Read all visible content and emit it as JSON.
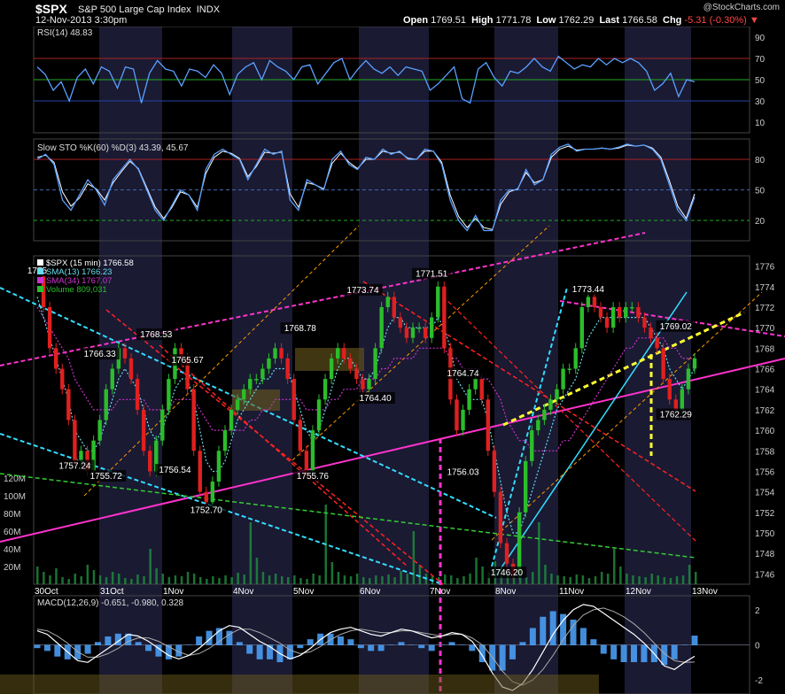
{
  "header": {
    "symbol": "$SPX",
    "name": "S&P 500 Large Cap Index",
    "exchange": "INDX",
    "datetime": "12-Nov-2013 3:30pm",
    "brand": "@StockCharts.com",
    "open_label": "Open",
    "open": "1769.51",
    "high_label": "High",
    "high": "1771.78",
    "low_label": "Low",
    "low": "1762.29",
    "last_label": "Last",
    "last": "1766.58",
    "chg_label": "Chg",
    "chg": "-5.31 (-0.30%)"
  },
  "colors": {
    "background": "#000000",
    "band": "#1a1a33",
    "price_up": "#2bbd2b",
    "price_down": "#e02020",
    "rsi_line": "#5aa0ff",
    "magenta": "#ff33cc",
    "cyan": "#33ddff",
    "red": "#ff2222",
    "orange": "#ff9900",
    "yellow": "#ffff33",
    "green_dash": "#33cc33",
    "volume": "#1f8f3f",
    "macd_hist": "#4da6ff"
  },
  "chart_data": [
    {
      "type": "line",
      "title": "RSI(14) 48.83",
      "ylim": [
        0,
        100
      ],
      "y_ticks": [
        "90",
        "70",
        "50",
        "30",
        "10"
      ],
      "reference_lines": [
        70,
        50,
        30
      ],
      "series": [
        {
          "name": "RSI(14)",
          "values": [
            62,
            55,
            40,
            48,
            30,
            52,
            60,
            46,
            62,
            58,
            42,
            62,
            60,
            28,
            56,
            68,
            60,
            58,
            44,
            60,
            58,
            52,
            64,
            56,
            36,
            55,
            62,
            66,
            50,
            68,
            62,
            58,
            50,
            62,
            64,
            46,
            56,
            66,
            70,
            50,
            60,
            68,
            60,
            56,
            62,
            54,
            62,
            60,
            58,
            40,
            46,
            54,
            62,
            32,
            28,
            60,
            66,
            52,
            44,
            58,
            56,
            62,
            70,
            62,
            58,
            72,
            66,
            60,
            64,
            62,
            70,
            64,
            70,
            66,
            70,
            66,
            58,
            40,
            46,
            56,
            34,
            50,
            48
          ]
        }
      ]
    },
    {
      "type": "line",
      "title": "Slow STO %K(60) %D(3) 43.39, 45.67",
      "ylim": [
        0,
        100
      ],
      "y_ticks": [
        "80",
        "50",
        "20"
      ],
      "reference_lines": [
        80,
        50,
        20
      ],
      "series": [
        {
          "name": "%K(60)",
          "values": [
            80,
            85,
            75,
            40,
            30,
            45,
            60,
            50,
            35,
            60,
            70,
            80,
            70,
            50,
            30,
            20,
            35,
            50,
            45,
            30,
            70,
            85,
            90,
            85,
            80,
            60,
            75,
            90,
            85,
            88,
            40,
            30,
            60,
            55,
            50,
            80,
            88,
            75,
            70,
            82,
            80,
            90,
            85,
            88,
            80,
            80,
            90,
            88,
            75,
            40,
            20,
            10,
            25,
            10,
            10,
            40,
            50,
            50,
            70,
            55,
            60,
            85,
            92,
            95,
            88,
            90,
            90,
            91,
            90,
            92,
            95,
            93,
            94,
            90,
            80,
            55,
            30,
            20,
            43
          ]
        },
        {
          "name": "%D(3)",
          "values": [
            82,
            84,
            77,
            48,
            34,
            42,
            56,
            51,
            40,
            57,
            68,
            78,
            71,
            52,
            33,
            22,
            33,
            48,
            45,
            33,
            66,
            82,
            88,
            86,
            81,
            63,
            73,
            87,
            86,
            87,
            46,
            33,
            57,
            55,
            51,
            76,
            86,
            77,
            71,
            80,
            80,
            88,
            86,
            87,
            81,
            80,
            88,
            88,
            77,
            45,
            24,
            13,
            22,
            13,
            11,
            36,
            48,
            51,
            67,
            57,
            60,
            82,
            90,
            93,
            89,
            90,
            90,
            91,
            90,
            91,
            94,
            93,
            94,
            91,
            82,
            59,
            34,
            22,
            46
          ]
        }
      ]
    },
    {
      "type": "line",
      "title": "$SPX (15 min) 1766.58",
      "ylim": [
        1745,
        1777
      ],
      "y_ticks": [
        "1776",
        "1774",
        "1772",
        "1770",
        "1768",
        "1766",
        "1764",
        "1762",
        "1760",
        "1758",
        "1756",
        "1754",
        "1752",
        "1750",
        "1748",
        "1746"
      ],
      "x": [
        "30Oct",
        "31Oct",
        "1Nov",
        "4Nov",
        "5Nov",
        "6Nov",
        "7Nov",
        "8Nov",
        "11Nov",
        "12Nov",
        "13Nov"
      ],
      "series": [
        {
          "name": "$SPX (15 min)",
          "values": [
            1775,
            1772,
            1768,
            1766,
            1764,
            1761,
            1757,
            1758,
            1756,
            1759,
            1761,
            1764,
            1766,
            1768,
            1767,
            1765,
            1762,
            1758,
            1756,
            1759,
            1762,
            1765,
            1768,
            1767,
            1764,
            1758,
            1754,
            1753,
            1755,
            1758,
            1760,
            1762,
            1763,
            1764,
            1765,
            1765,
            1766,
            1767,
            1768,
            1767,
            1765,
            1761,
            1758,
            1756,
            1760,
            1763,
            1765,
            1767,
            1768,
            1767,
            1766,
            1765,
            1764,
            1765,
            1768,
            1772,
            1773,
            1771,
            1770,
            1769,
            1770,
            1770,
            1769,
            1771,
            1774,
            1768,
            1763,
            1760,
            1762,
            1764,
            1765,
            1763,
            1758,
            1754,
            1749,
            1747,
            1746,
            1752,
            1757,
            1760,
            1761,
            1762,
            1763,
            1764,
            1766,
            1766,
            1768,
            1772,
            1773,
            1772,
            1771,
            1770,
            1772,
            1771,
            1772,
            1772,
            1771,
            1770,
            1769,
            1768,
            1765,
            1763,
            1762,
            1764,
            1766,
            1767
          ]
        },
        {
          "name": "SMA(13) 1766.23",
          "values": [
            1773,
            1771,
            1769,
            1767,
            1765,
            1763,
            1760,
            1759,
            1758,
            1758,
            1759,
            1761,
            1763,
            1765,
            1766,
            1765,
            1764,
            1762,
            1760,
            1759,
            1760,
            1762,
            1764,
            1765,
            1765,
            1763,
            1760,
            1757,
            1756,
            1756,
            1757,
            1759,
            1761,
            1762,
            1763,
            1764,
            1765,
            1765,
            1766,
            1766,
            1766,
            1764,
            1762,
            1760,
            1759,
            1760,
            1762,
            1764,
            1766,
            1767,
            1767,
            1766,
            1765,
            1765,
            1766,
            1768,
            1770,
            1771,
            1771,
            1770,
            1770,
            1770,
            1770,
            1770,
            1771,
            1770,
            1768,
            1765,
            1764,
            1763,
            1763,
            1763,
            1761,
            1758,
            1755,
            1752,
            1750,
            1750,
            1752,
            1754,
            1756,
            1758,
            1760,
            1762,
            1763,
            1764,
            1765,
            1767,
            1769,
            1770,
            1771,
            1771,
            1771,
            1771,
            1771,
            1771,
            1771,
            1771,
            1770,
            1769,
            1768,
            1766,
            1765,
            1764,
            1765,
            1766
          ]
        },
        {
          "name": "SMA(34) 1767.07",
          "values": [
            1772,
            1771,
            1770,
            1769,
            1768,
            1767,
            1765,
            1764,
            1763,
            1762,
            1762,
            1762,
            1762,
            1763,
            1763,
            1763,
            1763,
            1763,
            1762,
            1762,
            1762,
            1762,
            1763,
            1763,
            1763,
            1763,
            1762,
            1761,
            1760,
            1760,
            1760,
            1760,
            1760,
            1760,
            1761,
            1761,
            1762,
            1762,
            1763,
            1763,
            1763,
            1763,
            1763,
            1762,
            1762,
            1762,
            1762,
            1763,
            1763,
            1764,
            1764,
            1764,
            1765,
            1765,
            1765,
            1766,
            1766,
            1767,
            1767,
            1767,
            1767,
            1768,
            1768,
            1768,
            1768,
            1768,
            1767,
            1767,
            1766,
            1766,
            1766,
            1765,
            1765,
            1764,
            1763,
            1761,
            1760,
            1759,
            1759,
            1758,
            1758,
            1758,
            1758,
            1758,
            1759,
            1759,
            1760,
            1761,
            1762,
            1763,
            1764,
            1765,
            1766,
            1767,
            1768,
            1768,
            1769,
            1769,
            1769,
            1769,
            1769,
            1768,
            1768,
            1767,
            1767,
            1767
          ]
        }
      ],
      "price_labels": [
        {
          "text": "1773.74",
          "x": 52,
          "y": 1773.74
        },
        {
          "text": "1771.51",
          "x": 63,
          "y": 1775.3
        },
        {
          "text": "1773.44",
          "x": 88,
          "y": 1773.8
        },
        {
          "text": "1769.02",
          "x": 102,
          "y": 1770.2
        },
        {
          "text": "1768.78",
          "x": 42,
          "y": 1770.0
        },
        {
          "text": "1768.53",
          "x": 19,
          "y": 1769.4
        },
        {
          "text": "1766.33",
          "x": 10,
          "y": 1767.5
        },
        {
          "text": "1765.67",
          "x": 24,
          "y": 1766.9
        },
        {
          "text": "1764.74",
          "x": 68,
          "y": 1765.6
        },
        {
          "text": "1764.40",
          "x": 54,
          "y": 1763.2
        },
        {
          "text": "1762.29",
          "x": 102,
          "y": 1761.6
        },
        {
          "text": "1757.24",
          "x": 6,
          "y": 1756.6
        },
        {
          "text": "1755.72",
          "x": 11,
          "y": 1755.6
        },
        {
          "text": "1756.54",
          "x": 22,
          "y": 1756.2
        },
        {
          "text": "1755.76",
          "x": 44,
          "y": 1755.6
        },
        {
          "text": "1756.03",
          "x": 68,
          "y": 1756.0
        },
        {
          "text": "1752.70",
          "x": 27,
          "y": 1752.3
        },
        {
          "text": "1746.20",
          "x": 75,
          "y": 1746.2
        },
        {
          "text": "1775",
          "x": 0,
          "y": 1775.6
        }
      ],
      "legend": [
        "$SPX (15 min) 1766.58",
        "SMA(13) 1766.23",
        "SMA(34) 1767.07",
        "Volume 809,031"
      ]
    },
    {
      "type": "bar",
      "title": "Volume 809,031",
      "ylim": [
        0,
        130
      ],
      "y_ticks": [
        "120M",
        "100M",
        "80M",
        "60M",
        "40M",
        "20M"
      ],
      "values": [
        20,
        14,
        10,
        18,
        8,
        6,
        12,
        9,
        22,
        16,
        10,
        8,
        14,
        12,
        7,
        6,
        11,
        9,
        40,
        18,
        12,
        8,
        10,
        9,
        14,
        12,
        8,
        6,
        9,
        7,
        10,
        8,
        13,
        11,
        70,
        30,
        14,
        10,
        12,
        9,
        8,
        10,
        7,
        6,
        12,
        10,
        90,
        25,
        14,
        10,
        9,
        12,
        8,
        7,
        10,
        9,
        11,
        8,
        15,
        12,
        60,
        22,
        12,
        9,
        8,
        11,
        10,
        7,
        9,
        12,
        30,
        20,
        14,
        26,
        18,
        12,
        16,
        10,
        8,
        14,
        70,
        22,
        12,
        10,
        9,
        8,
        11,
        10,
        7,
        9,
        14,
        12,
        40,
        20,
        12,
        10,
        9,
        8,
        12,
        10,
        8,
        7,
        9,
        10,
        22,
        14
      ]
    },
    {
      "type": "line",
      "title": "MACD(12,26,9) -0.651, -0.980, 0.328",
      "ylim": [
        -2.8,
        2.8
      ],
      "y_ticks": [
        "2",
        "0",
        "-2"
      ],
      "series": [
        {
          "name": "MACD(12,26,9)",
          "values": [
            0.8,
            0.6,
            0.1,
            -0.4,
            -0.9,
            -1.0,
            -0.6,
            -0.2,
            0.2,
            0.6,
            0.5,
            0.2,
            -0.2,
            -0.6,
            -0.8,
            -0.6,
            -0.2,
            0.3,
            0.8,
            1.1,
            1.0,
            0.6,
            0.2,
            -0.1,
            -0.5,
            -0.8,
            -0.6,
            -0.2,
            0.3,
            0.7,
            0.9,
            1.0,
            0.8,
            0.6,
            0.5,
            0.7,
            0.9,
            0.8,
            0.6,
            0.4,
            0.5,
            0.7,
            0.6,
            0.2,
            -0.6,
            -1.6,
            -2.4,
            -2.6,
            -2.2,
            -1.4,
            -0.4,
            0.6,
            1.4,
            2.0,
            2.3,
            2.2,
            1.8,
            1.4,
            1.0,
            0.6,
            0.1,
            -0.5,
            -1.2,
            -1.4,
            -1.0,
            -0.65
          ]
        },
        {
          "name": "Signal",
          "values": [
            0.9,
            0.8,
            0.5,
            0.1,
            -0.4,
            -0.7,
            -0.7,
            -0.5,
            -0.2,
            0.2,
            0.4,
            0.4,
            0.2,
            -0.1,
            -0.4,
            -0.6,
            -0.5,
            -0.2,
            0.2,
            0.6,
            0.9,
            0.9,
            0.7,
            0.4,
            0.1,
            -0.3,
            -0.5,
            -0.4,
            -0.1,
            0.3,
            0.6,
            0.8,
            0.9,
            0.8,
            0.7,
            0.7,
            0.8,
            0.8,
            0.7,
            0.6,
            0.5,
            0.6,
            0.6,
            0.4,
            0.0,
            -0.7,
            -1.5,
            -2.1,
            -2.3,
            -2.0,
            -1.4,
            -0.6,
            0.3,
            1.1,
            1.7,
            2.0,
            2.1,
            1.9,
            1.6,
            1.2,
            0.7,
            0.1,
            -0.5,
            -0.9,
            -1.0,
            -0.98
          ]
        },
        {
          "name": "Histogram",
          "values": [
            -0.1,
            -0.2,
            -0.4,
            -0.5,
            -0.5,
            -0.3,
            0.1,
            0.3,
            0.4,
            0.4,
            0.1,
            -0.2,
            -0.4,
            -0.5,
            -0.4,
            0.0,
            0.3,
            0.5,
            0.6,
            0.5,
            0.1,
            -0.3,
            -0.5,
            -0.5,
            -0.6,
            -0.5,
            -0.1,
            0.2,
            0.4,
            0.4,
            0.3,
            0.2,
            -0.1,
            -0.2,
            -0.2,
            0.0,
            0.1,
            0.0,
            -0.1,
            -0.2,
            0.0,
            0.1,
            0.0,
            -0.2,
            -0.6,
            -0.9,
            -0.9,
            -0.5,
            0.1,
            0.6,
            1.0,
            1.2,
            1.1,
            0.9,
            0.6,
            0.2,
            -0.3,
            -0.5,
            -0.6,
            -0.6,
            -0.6,
            -0.6,
            -0.7,
            -0.5,
            0.0,
            0.33
          ]
        }
      ]
    }
  ]
}
